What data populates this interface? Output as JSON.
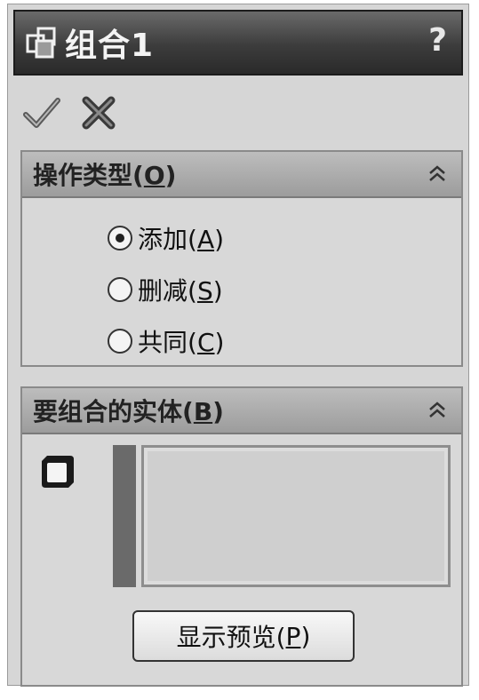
{
  "window": {
    "title": "组合1",
    "help_label": "?",
    "icon": "combine-icon"
  },
  "actions": {
    "ok_icon": "checkmark-icon",
    "cancel_icon": "close-icon"
  },
  "operation_type": {
    "title": "操作类型(",
    "mnemonic": "O",
    "title_end": ")",
    "options": [
      {
        "label": "添加(",
        "mnemonic": "A",
        "end": ")",
        "checked": true
      },
      {
        "label": "删减(",
        "mnemonic": "S",
        "end": ")",
        "checked": false
      },
      {
        "label": "共同(",
        "mnemonic": "C",
        "end": ")",
        "checked": false
      }
    ]
  },
  "bodies": {
    "title": "要组合的实体(",
    "mnemonic": "B",
    "title_end": ")",
    "icon": "solid-body-icon",
    "preview_label": "显示预览(",
    "preview_mnemonic": "P",
    "preview_end": ")"
  }
}
